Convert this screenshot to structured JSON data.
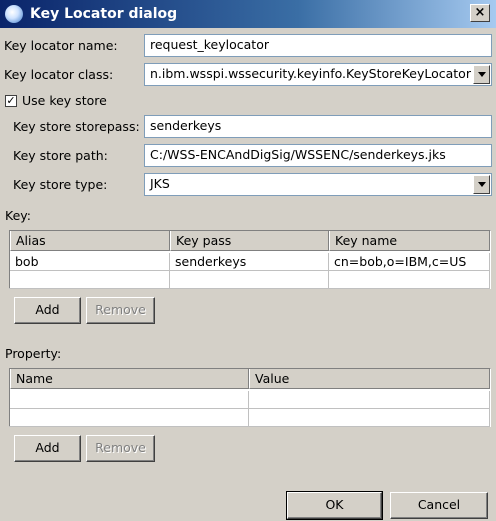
{
  "window": {
    "title": "Key Locator dialog",
    "close_label": "×"
  },
  "fields": {
    "key_locator_name": {
      "label": "Key locator name:",
      "value": "request_keylocator"
    },
    "key_locator_class": {
      "label": "Key locator class:",
      "value": "n.ibm.wsspi.wssecurity.keyinfo.KeyStoreKeyLocator"
    },
    "use_key_store": {
      "label": "Use key store",
      "checked": true,
      "mark": "✓"
    },
    "key_store_storepass": {
      "label": "Key store storepass:",
      "value": "senderkeys"
    },
    "key_store_path": {
      "label": "Key store path:",
      "value": "C:/WSS-ENCAndDigSig/WSSENC/senderkeys.jks"
    },
    "key_store_type": {
      "label": "Key store type:",
      "value": "JKS"
    }
  },
  "key_section": {
    "label": "Key:",
    "columns": [
      "Alias",
      "Key pass",
      "Key name"
    ],
    "rows": [
      [
        "bob",
        "senderkeys",
        "cn=bob,o=IBM,c=US"
      ]
    ],
    "add_label": "Add",
    "remove_label": "Remove"
  },
  "property_section": {
    "label": "Property:",
    "columns": [
      "Name",
      "Value"
    ],
    "add_label": "Add",
    "remove_label": "Remove"
  },
  "footer": {
    "ok_label": "OK",
    "cancel_label": "Cancel"
  }
}
